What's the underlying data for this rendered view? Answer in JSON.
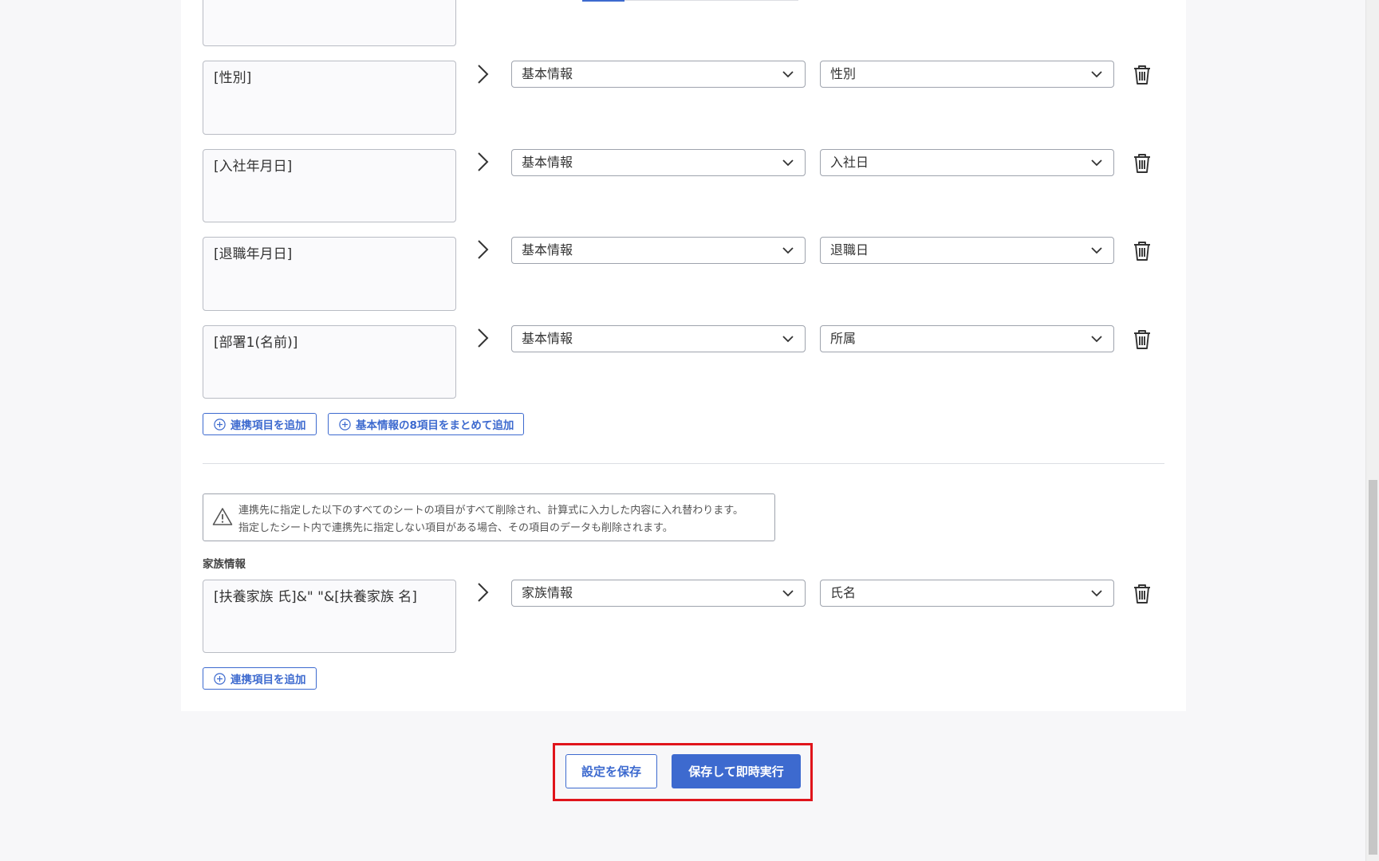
{
  "rows": [
    {
      "formula": "[性別]",
      "category": "基本情報",
      "field": "性別"
    },
    {
      "formula": "[入社年月日]",
      "category": "基本情報",
      "field": "入社日"
    },
    {
      "formula": "[退職年月日]",
      "category": "基本情報",
      "field": "退職日"
    },
    {
      "formula": "[部署1(名前)]",
      "category": "基本情報",
      "field": "所属"
    }
  ],
  "basic_section": {
    "add_item_label": "連携項目を追加",
    "add_bulk_label": "基本情報の8項目をまとめて追加"
  },
  "warning": {
    "line1": "連携先に指定した以下のすべてのシートの項目がすべて削除され、計算式に入力した内容に入れ替わります。",
    "line2": "指定したシート内で連携先に指定しない項目がある場合、その項目のデータも削除されます。"
  },
  "family_section": {
    "title": "家族情報",
    "rows": [
      {
        "formula": "[扶養家族 氏]&\" \"&[扶養家族 名]",
        "category": "家族情報",
        "field": "氏名"
      }
    ],
    "add_item_label": "連携項目を追加"
  },
  "footer": {
    "save_label": "設定を保存",
    "save_run_label": "保存して即時実行"
  },
  "colors": {
    "accent": "#3d6acf",
    "highlight": "#e0141b"
  }
}
